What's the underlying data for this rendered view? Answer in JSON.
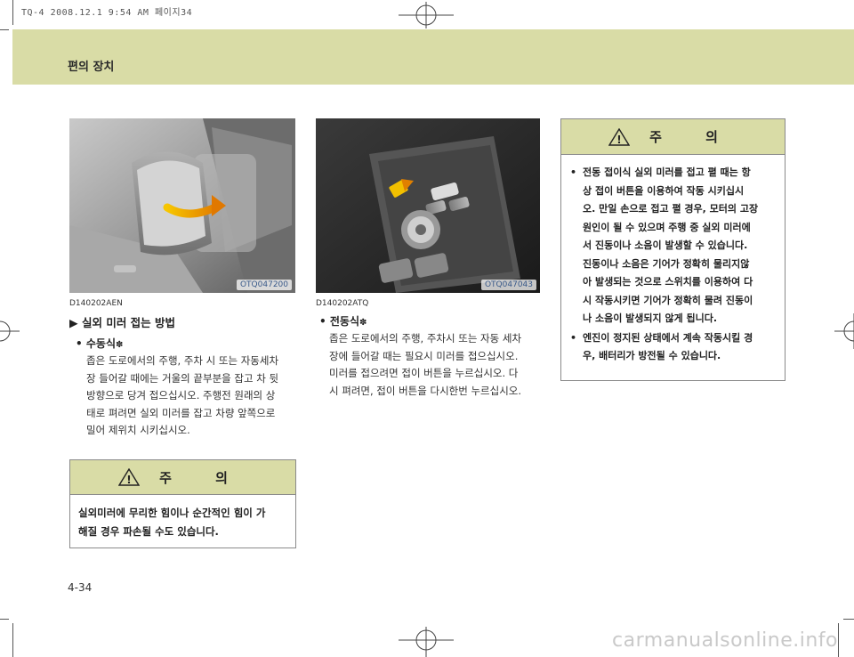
{
  "print_header": "TQ-4  2008.12.1 9:54 AM 페이지34",
  "section_title": "편의 장치",
  "left_column": {
    "image_code": "OTQ047200",
    "ref_code": "D140202AEN",
    "heading": "▶ 실외 미러 접는 방법",
    "bullet_title": "수동식",
    "bullet_mark": "✽",
    "body": "좁은 도로에서의 주행, 주차 시 또는 자동세차장 들어갈 때에는 거울의 끝부분을 잡고 차 뒷방향으로 당겨 접으십시오. 주행전 원래의 상태로 펴려면 실외 미러를 잡고 차량 앞쪽으로 밀어 제위치 시키십시오.",
    "body_lines": [
      "좁은 도로에서의 주행, 주차 시 또는 자동세차",
      "장 들어갈 때에는 거울의 끝부분을 잡고 차 뒷",
      "방향으로 당겨 접으십시오. 주행전 원래의 상",
      "태로 펴려면 실외 미러를 잡고 차량 앞쪽으로",
      "밀어 제위치 시키십시오."
    ],
    "caution": {
      "title": "주   의",
      "lines": [
        "실외미러에 무리한 힘이나 순간적인 힘이 가",
        "해질 경우 파손될 수도 있습니다."
      ]
    }
  },
  "middle_column": {
    "image_code": "OTQ047043",
    "ref_code": "D140202ATQ",
    "bullet_title": "전동식",
    "bullet_mark": "✽",
    "body_lines": [
      "좁은 도로에서의 주행, 주차시 또는 자동 세차",
      "장에 들어갈 때는 필요시 미러를 접으십시오.",
      "미러를 접으려면 접이 버튼을 누르십시오. 다",
      "시 펴려면, 접이 버튼을 다시한번 누르십시오."
    ]
  },
  "right_column": {
    "caution": {
      "title": "주   의",
      "items": [
        [
          "전동 접이식 실외 미러를 접고 펼 때는 항",
          "상 접이 버튼을 이용하여 작동 시키십시",
          "오. 만일 손으로 접고 펼 경우, 모터의 고장",
          "원인이 될 수 있으며 주행 중 실외 미러에",
          "서 진동이나 소음이 발생할 수 있습니다.",
          "진동이나 소음은 기어가 정확히 물리지않",
          "아 발생되는 것으로 스위치를 이용하여 다",
          "시 작동시키면 기어가 정확히 물려 진동이",
          "나 소음이 발생되지 않게 됩니다."
        ],
        [
          "엔진이 정지된 상태에서 계속 작동시킬 경",
          "우, 배터리가 방전될 수 있습니다."
        ]
      ]
    }
  },
  "page_number": "4-34",
  "watermark": "carmanualsonline.info",
  "colors": {
    "band": "#d9dca6",
    "border": "#8a8a8a",
    "image_code_text": "#3a5a8a"
  },
  "icons": [
    "warning-triangle-icon",
    "registration-mark-icon"
  ]
}
